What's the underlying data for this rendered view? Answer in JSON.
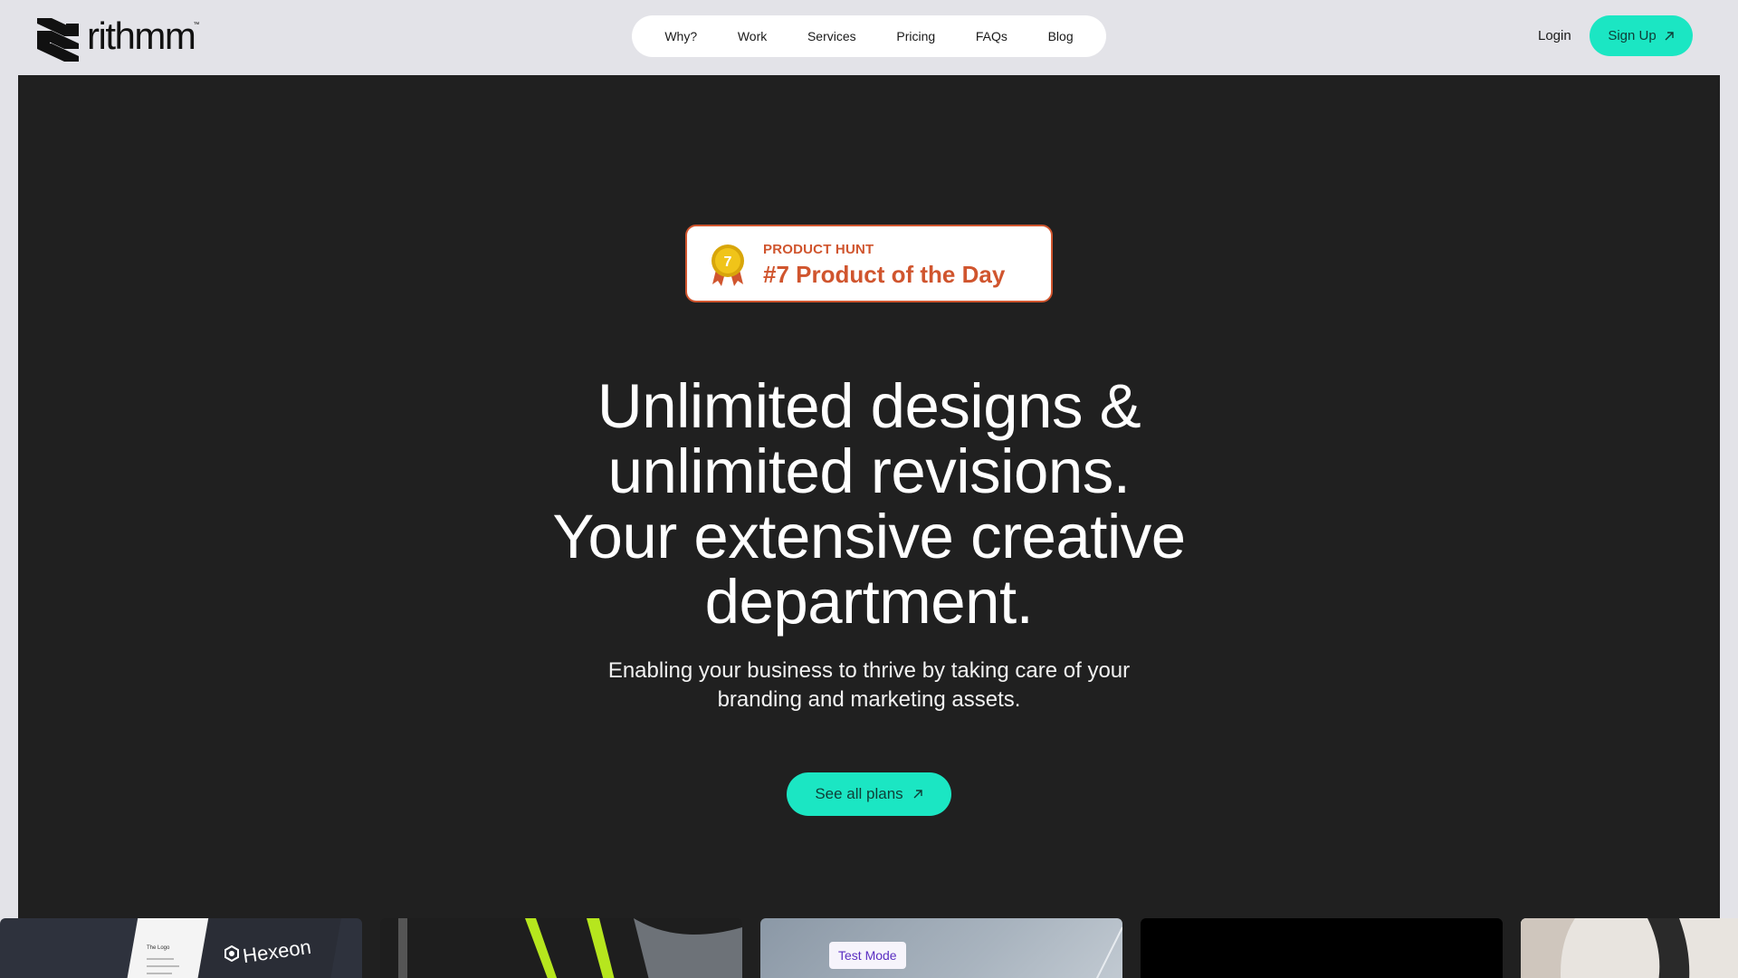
{
  "brand": {
    "name": "rithmm",
    "tm": "™"
  },
  "nav": {
    "items": [
      {
        "label": "Why?"
      },
      {
        "label": "Work"
      },
      {
        "label": "Services"
      },
      {
        "label": "Pricing"
      },
      {
        "label": "FAQs"
      },
      {
        "label": "Blog"
      }
    ]
  },
  "auth": {
    "login_label": "Login",
    "signup_label": "Sign Up"
  },
  "badge": {
    "overline": "PRODUCT HUNT",
    "title": "#7 Product of the Day",
    "medal_number": "7"
  },
  "hero": {
    "headline_lines": [
      "Unlimited designs &",
      "unlimited revisions.",
      "Your extensive creative",
      "department."
    ],
    "subhead_lines": [
      "Enabling your business to thrive by taking care of your",
      "branding and marketing assets."
    ],
    "cta_label": "See all plans"
  },
  "gallery": {
    "hexeon_label": "Hexeon",
    "hexeon_small": "The Logo",
    "test_mode_label": "Test Mode"
  },
  "colors": {
    "accent": "#1be6c3",
    "hero_bg": "#202020",
    "page_bg": "#e3e3e8",
    "badge_orange": "#d0552e"
  }
}
